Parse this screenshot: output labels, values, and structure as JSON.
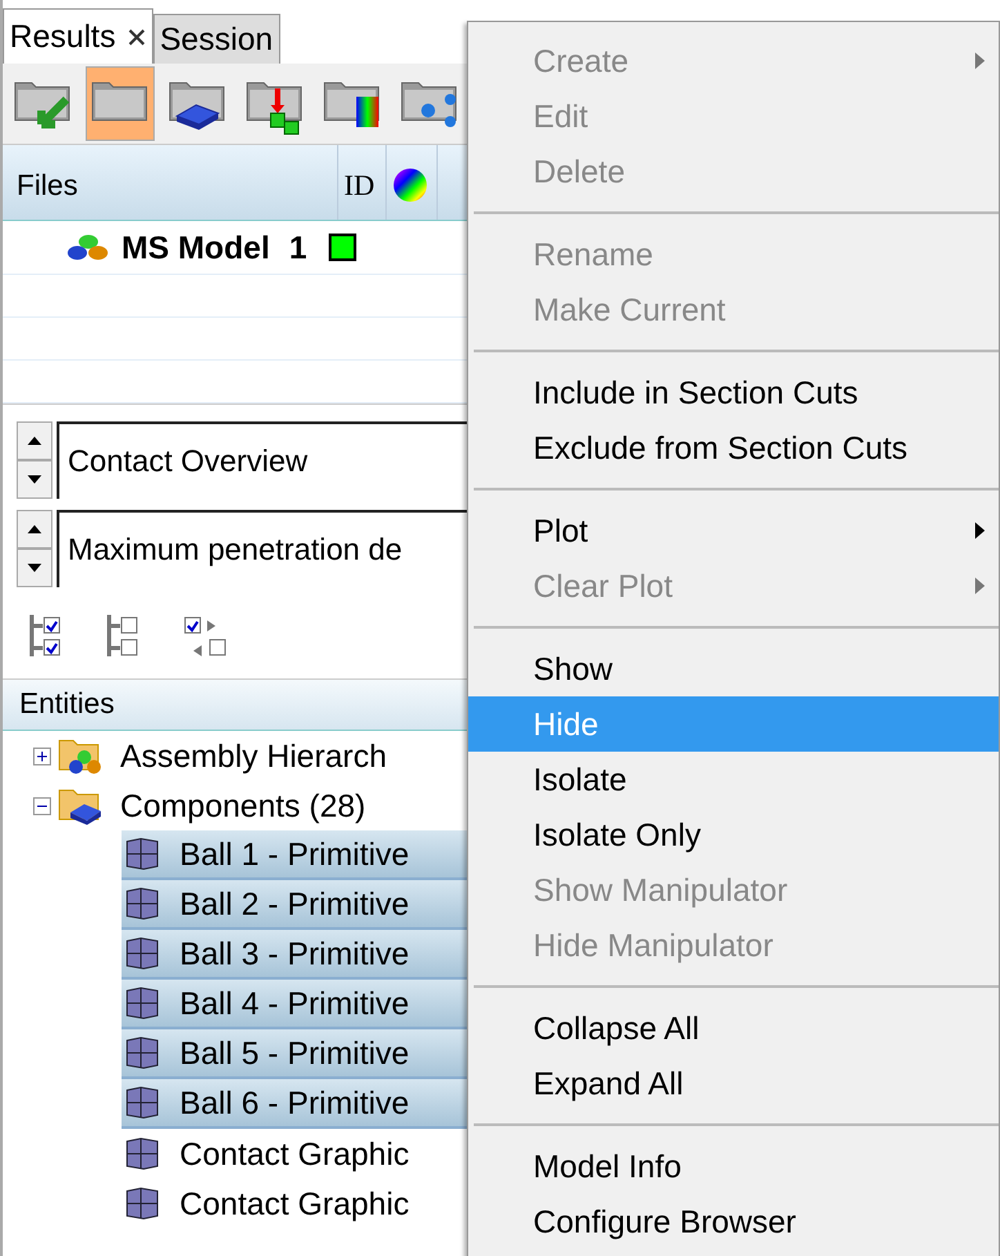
{
  "tabs": [
    {
      "label": "Results",
      "closable": true,
      "selected": true
    },
    {
      "label": "Session",
      "closable": false,
      "selected": false
    }
  ],
  "toolbar": [
    {
      "kind": "import",
      "selected": false
    },
    {
      "kind": "folder",
      "selected": true
    },
    {
      "kind": "component",
      "selected": false
    },
    {
      "kind": "assembly",
      "selected": false
    },
    {
      "kind": "contour",
      "selected": false
    },
    {
      "kind": "network",
      "selected": false
    }
  ],
  "files_table": {
    "columns": [
      "Files",
      "ID"
    ],
    "rows": [
      {
        "name": "MS Model",
        "id": "1",
        "color": "#00ff00"
      }
    ]
  },
  "fields": [
    {
      "value": "Contact Overview"
    },
    {
      "value": "Maximum penetration de"
    }
  ],
  "entities": {
    "header": "Entities",
    "tree": [
      {
        "label": "Assembly Hierarch",
        "kind": "assembly",
        "expanded": false
      },
      {
        "label": "Components (28)",
        "kind": "component",
        "expanded": true,
        "children": [
          {
            "label": "Ball 1 - Primitive",
            "selected": true
          },
          {
            "label": "Ball 2 - Primitive",
            "selected": true
          },
          {
            "label": "Ball 3 - Primitive",
            "selected": true
          },
          {
            "label": "Ball 4 - Primitive",
            "selected": true
          },
          {
            "label": "Ball 5 - Primitive",
            "selected": true
          },
          {
            "label": "Ball 6 - Primitive",
            "selected": true
          },
          {
            "label": "Contact Graphic",
            "selected": false
          },
          {
            "label": "Contact Graphic",
            "selected": false
          }
        ]
      }
    ]
  },
  "context_menu": [
    {
      "kind": "item",
      "label": "Create",
      "disabled": true,
      "submenu": true,
      "selected": false
    },
    {
      "kind": "item",
      "label": "Edit",
      "disabled": true,
      "submenu": false,
      "selected": false
    },
    {
      "kind": "item",
      "label": "Delete",
      "disabled": true,
      "submenu": false,
      "selected": false
    },
    {
      "kind": "separator"
    },
    {
      "kind": "item",
      "label": "Rename",
      "disabled": true,
      "submenu": false,
      "selected": false
    },
    {
      "kind": "item",
      "label": "Make Current",
      "disabled": true,
      "submenu": false,
      "selected": false
    },
    {
      "kind": "separator"
    },
    {
      "kind": "item",
      "label": "Include in Section Cuts",
      "disabled": false,
      "submenu": false,
      "selected": false
    },
    {
      "kind": "item",
      "label": "Exclude from Section Cuts",
      "disabled": false,
      "submenu": false,
      "selected": false
    },
    {
      "kind": "separator"
    },
    {
      "kind": "item",
      "label": "Plot",
      "disabled": false,
      "submenu": true,
      "selected": false
    },
    {
      "kind": "item",
      "label": "Clear Plot",
      "disabled": true,
      "submenu": true,
      "selected": false
    },
    {
      "kind": "separator"
    },
    {
      "kind": "item",
      "label": "Show",
      "disabled": false,
      "submenu": false,
      "selected": false
    },
    {
      "kind": "item",
      "label": "Hide",
      "disabled": false,
      "submenu": false,
      "selected": true
    },
    {
      "kind": "item",
      "label": "Isolate",
      "disabled": false,
      "submenu": false,
      "selected": false
    },
    {
      "kind": "item",
      "label": "Isolate Only",
      "disabled": false,
      "submenu": false,
      "selected": false
    },
    {
      "kind": "item",
      "label": "Show Manipulator",
      "disabled": true,
      "submenu": false,
      "selected": false
    },
    {
      "kind": "item",
      "label": "Hide Manipulator",
      "disabled": true,
      "submenu": false,
      "selected": false
    },
    {
      "kind": "separator"
    },
    {
      "kind": "item",
      "label": "Collapse All",
      "disabled": false,
      "submenu": false,
      "selected": false
    },
    {
      "kind": "item",
      "label": "Expand All",
      "disabled": false,
      "submenu": false,
      "selected": false
    },
    {
      "kind": "separator"
    },
    {
      "kind": "item",
      "label": "Model Info",
      "disabled": false,
      "submenu": false,
      "selected": false
    },
    {
      "kind": "item",
      "label": "Configure Browser",
      "disabled": false,
      "submenu": false,
      "selected": false
    }
  ]
}
